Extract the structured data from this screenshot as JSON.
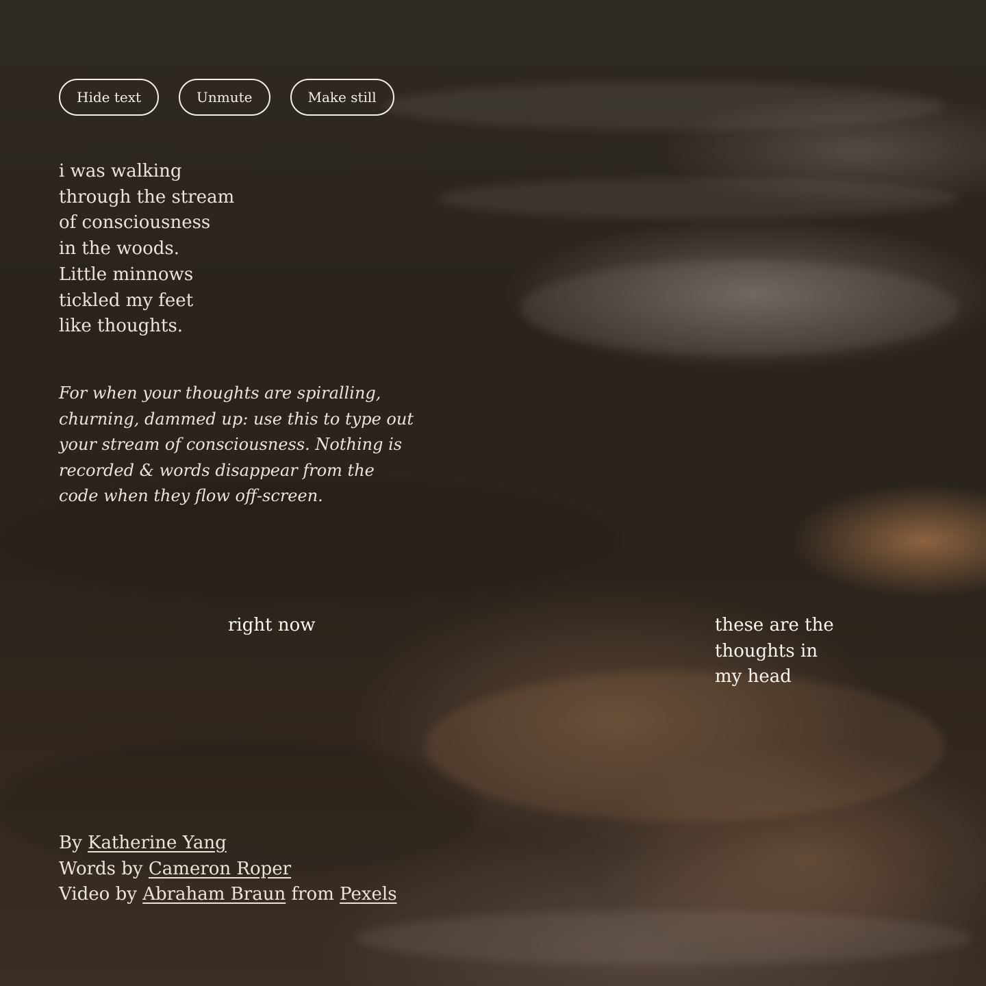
{
  "controls": {
    "hide_text": "Hide text",
    "unmute": "Unmute",
    "make_still": "Make still"
  },
  "poem": {
    "lines": [
      "i was walking",
      "through the stream",
      "of consciousness",
      "in the woods.",
      "Little minnows",
      "tickled my feet",
      "like thoughts."
    ]
  },
  "note": "For when your thoughts are spiralling, churning, dammed up: use this to type out your stream of consciousness. Nothing is recorded & words disappear from the code when they flow off-screen.",
  "stream_words": {
    "first": "right now",
    "second": "these are the thoughts in my head"
  },
  "credits": {
    "by_label": "By",
    "by_name": "Katherine Yang",
    "words_label": "Words by",
    "words_name": "Cameron Roper",
    "video_label": "Video by",
    "video_name": "Abraham Braun",
    "from_label": "from",
    "source_name": "Pexels"
  },
  "colors": {
    "text": "#ece4da",
    "button_border": "#f4efe8",
    "background": "#2b241c"
  }
}
